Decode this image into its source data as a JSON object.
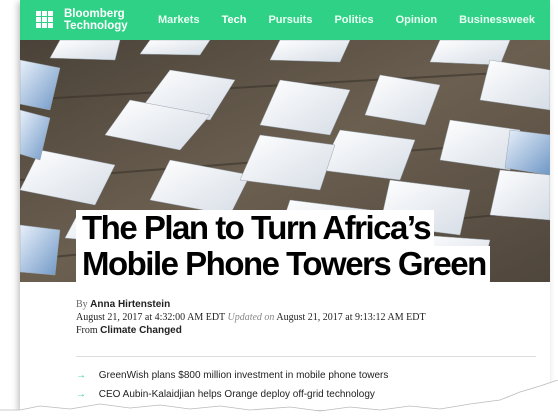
{
  "brand": {
    "line1": "Bloomberg",
    "line2": "Technology",
    "color": "#2fd186"
  },
  "nav": [
    {
      "label": "Markets",
      "active": false
    },
    {
      "label": "Tech",
      "active": true
    },
    {
      "label": "Pursuits",
      "active": false
    },
    {
      "label": "Politics",
      "active": false
    },
    {
      "label": "Opinion",
      "active": false
    },
    {
      "label": "Businessweek",
      "active": false
    }
  ],
  "article": {
    "headline_line1": "The Plan to Turn Africa’s",
    "headline_line2": "Mobile Phone Towers Green",
    "by_prefix": "By",
    "author": "Anna Hirtenstein",
    "published": "August 21, 2017 at 4:32:00 AM EDT",
    "updated_label": "Updated on",
    "updated": "August 21, 2017 at 9:13:12 AM EDT",
    "from_prefix": "From",
    "section": "Climate Changed",
    "bullets": [
      "GreenWish plans $800 million investment in mobile phone towers",
      "CEO Aubin-Kalaidjian helps Orange deploy off-grid technology"
    ]
  }
}
